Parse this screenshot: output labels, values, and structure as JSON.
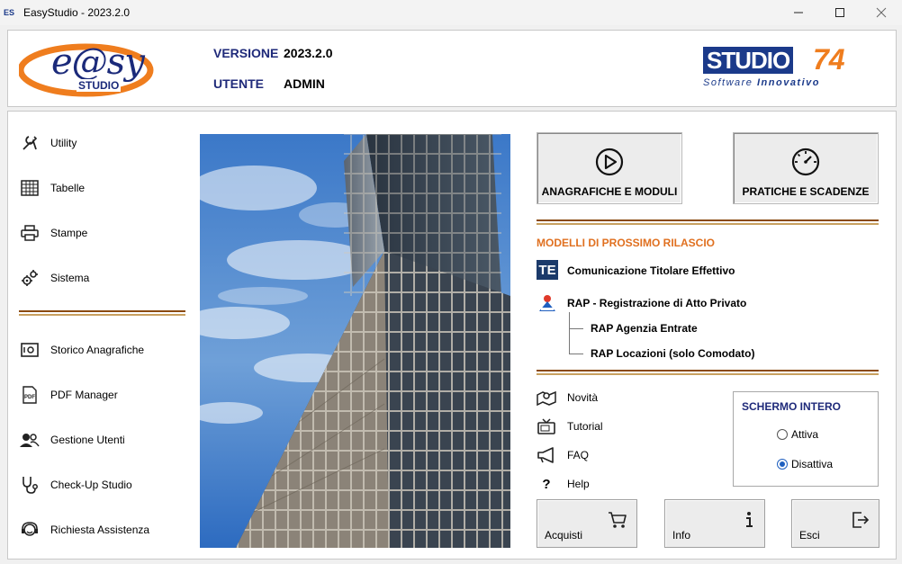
{
  "window": {
    "title": "EasyStudio - 2023.2.0",
    "app_icon_text": "ES"
  },
  "header": {
    "logo_text": "e@sy",
    "logo_subtext": "STUDIO",
    "version_label": "VERSIONE",
    "version_value": "2023.2.0",
    "user_label": "UTENTE",
    "user_value": "ADMIN",
    "brand_text": "STUDIO",
    "brand_number": "74",
    "brand_tagline_a": "Software",
    "brand_tagline_b": "Innovativo"
  },
  "nav": {
    "top": [
      {
        "label": "Utility",
        "icon": "tools-icon"
      },
      {
        "label": "Tabelle",
        "icon": "table-icon"
      },
      {
        "label": "Stampe",
        "icon": "printer-icon"
      },
      {
        "label": "Sistema",
        "icon": "gears-icon"
      }
    ],
    "bottom": [
      {
        "label": "Storico Anagrafiche",
        "icon": "safe-icon"
      },
      {
        "label": "PDF Manager",
        "icon": "pdf-icon"
      },
      {
        "label": "Gestione Utenti",
        "icon": "users-icon"
      },
      {
        "label": "Check-Up Studio",
        "icon": "stethoscope-icon"
      },
      {
        "label": "Richiesta Assistenza",
        "icon": "headset-icon"
      }
    ]
  },
  "actions": {
    "anagrafiche_label": "ANAGRAFICHE E MODULI",
    "pratiche_label": "PRATICHE E SCADENZE"
  },
  "models": {
    "section_title": "MODELLI DI PROSSIMO RILASCIO",
    "te_badge": "TE",
    "item1": "Comunicazione Titolare Effettivo",
    "item2": "RAP - Registrazione di Atto Privato",
    "item2_sub1": "RAP Agenzia Entrate",
    "item2_sub2": "RAP Locazioni (solo Comodato)"
  },
  "links": [
    {
      "label": "Novità",
      "icon": "map-icon"
    },
    {
      "label": "Tutorial",
      "icon": "tv-icon"
    },
    {
      "label": "FAQ",
      "icon": "megaphone-icon"
    },
    {
      "label": "Help",
      "icon": "question-icon"
    }
  ],
  "fullscreen": {
    "title": "SCHERMO INTERO",
    "option_on": "Attiva",
    "option_off": "Disattiva",
    "selected": "Disattiva"
  },
  "bottom_buttons": {
    "acquisti": "Acquisti",
    "info": "Info",
    "esci": "Esci"
  },
  "colors": {
    "accent_orange": "#e07020",
    "label_blue": "#1f2a7a",
    "brand_blue": "#1b3a8a",
    "radio_blue": "#1f5fbf"
  }
}
